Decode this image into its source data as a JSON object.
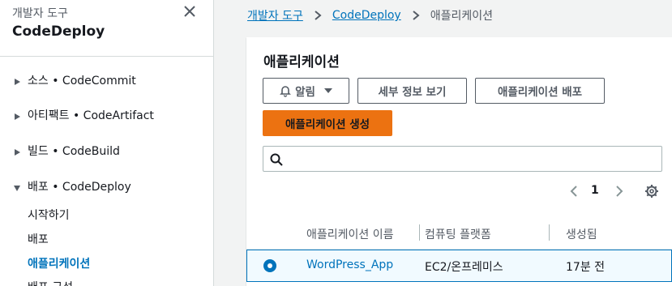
{
  "sidebar": {
    "subtitle": "개발자 도구",
    "title": "CodeDeploy",
    "sections": [
      {
        "label": "소스 • CodeCommit"
      },
      {
        "label": "아티팩트 • CodeArtifact"
      },
      {
        "label": "빌드 • CodeBuild"
      },
      {
        "label": "배포 • CodeDeploy"
      }
    ],
    "links": [
      {
        "label": "시작하기"
      },
      {
        "label": "배포"
      },
      {
        "label": "애플리케이션"
      },
      {
        "label": "배포 구성"
      }
    ]
  },
  "breadcrumb": {
    "items": [
      {
        "label": "개발자 도구"
      },
      {
        "label": "CodeDeploy"
      },
      {
        "label": "애플리케이션"
      }
    ]
  },
  "panel": {
    "title": "애플리케이션",
    "buttons": {
      "notify": "알림",
      "details": "세부 정보 보기",
      "deploy": "애플리케이션 배포",
      "create": "애플리케이션 생성"
    },
    "search": {
      "placeholder": "",
      "value": ""
    },
    "pagination": {
      "current_page": "1"
    },
    "table": {
      "columns": [
        "애플리케이션 이름",
        "컴퓨팅 플랫폼",
        "생성됨"
      ],
      "rows": [
        {
          "name": "WordPress_App",
          "platform": "EC2/온프레미스",
          "created": "17분 전",
          "selected": true
        }
      ]
    }
  },
  "colors": {
    "accent": "#0073bb",
    "primary_button": "#ec7211",
    "background": "#f2f3f3"
  },
  "icons": [
    "close-icon",
    "caret-right-icon",
    "caret-down-icon",
    "bell-icon",
    "search-icon",
    "chevron-left-icon",
    "chevron-right-icon",
    "gear-icon"
  ]
}
